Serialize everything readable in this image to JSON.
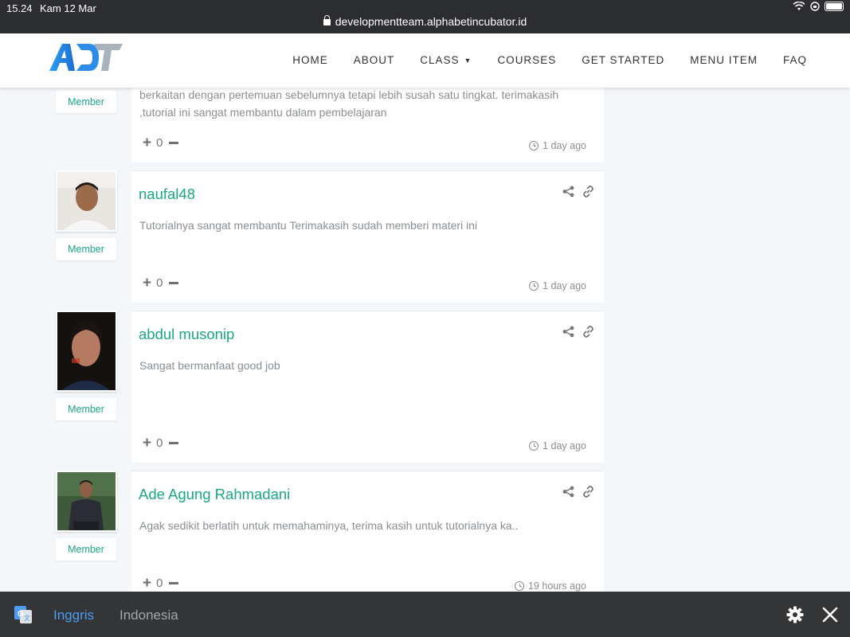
{
  "status_bar": {
    "time": "15.24",
    "date": "Kam 12 Mar",
    "url": "developmentteam.alphabetincubator.id"
  },
  "header": {
    "logo_text": "ADT",
    "nav": [
      "HOME",
      "ABOUT",
      "CLASS",
      "COURSES",
      "GET STARTED",
      "MENU ITEM",
      "FAQ"
    ]
  },
  "comments": [
    {
      "author": "",
      "role": "Member",
      "text": "berkaitan dengan pertemuan sebelumnya tetapi lebih susah satu tingkat. terimakasih ,tutorial ini sangat membantu dalam pembelajaran",
      "votes": "0",
      "time": "1 day ago"
    },
    {
      "author": "naufal48",
      "role": "Member",
      "text": "Tutorialnya sangat membantu Terimakasih sudah memberi materi ini",
      "votes": "0",
      "time": "1 day ago"
    },
    {
      "author": "abdul musonip",
      "role": "Member",
      "text": "Sangat bermanfaat good job",
      "votes": "0",
      "time": "1 day ago"
    },
    {
      "author": "Ade Agung Rahmadani",
      "role": "Member",
      "text": "Agak sedikit berlatih untuk memahaminya, terima kasih untuk tutorialnya ka..",
      "votes": "0",
      "time": "19 hours ago"
    }
  ],
  "translate_bar": {
    "source_language": "Inggris",
    "target_language": "Indonesia"
  },
  "colors": {
    "accent": "#1aa886",
    "translate_active": "#4d9cf5"
  }
}
